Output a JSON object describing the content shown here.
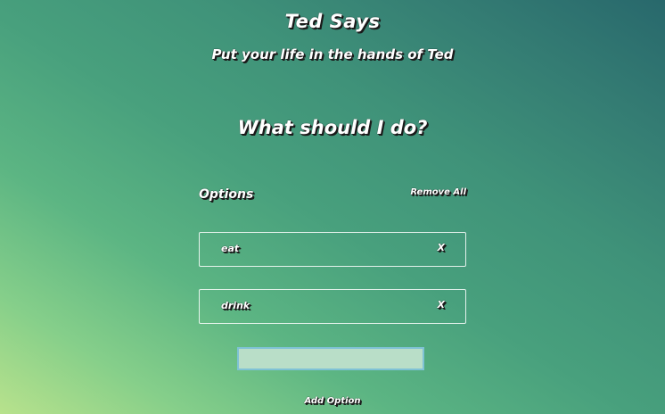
{
  "header": {
    "title": "Ted Says",
    "subtitle": "Put your life in the hands of Ted"
  },
  "action": {
    "label": "What should I do?"
  },
  "options": {
    "heading": "Options",
    "remove_all_label": "Remove All",
    "items": [
      {
        "text": "eat",
        "remove_label": "X"
      },
      {
        "text": "drink",
        "remove_label": "X"
      }
    ]
  },
  "add_form": {
    "input_value": "",
    "button_label": "Add Option"
  },
  "colors": {
    "gradient_light": "#b8e28c",
    "gradient_mid": "#48a07d",
    "gradient_dark": "#28686c",
    "input_background": "#b9dec8",
    "input_border": "#7fc2d6"
  }
}
